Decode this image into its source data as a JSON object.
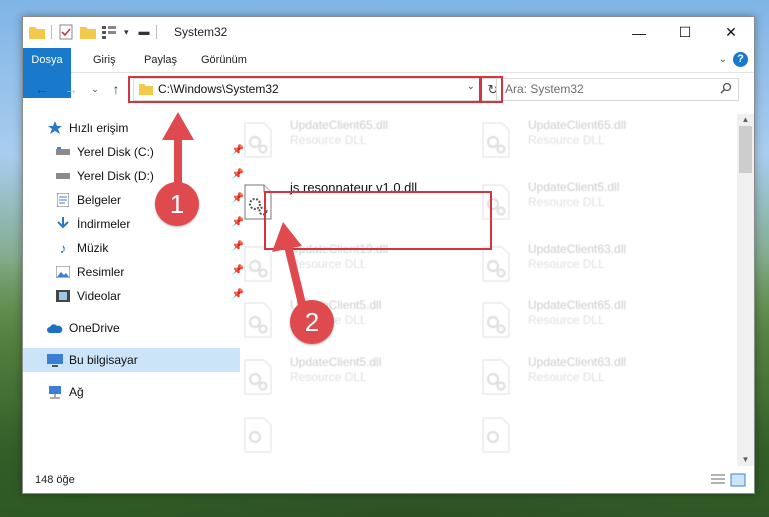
{
  "window": {
    "title": "System32",
    "controls": {
      "minimize_icon": "minimize-icon",
      "maximize_icon": "maximize-icon",
      "close_icon": "close-icon"
    }
  },
  "ribbon": {
    "tabs": [
      {
        "label": "Dosya"
      },
      {
        "label": "Giriş"
      },
      {
        "label": "Paylaş"
      },
      {
        "label": "Görünüm"
      }
    ]
  },
  "address": {
    "path": "C:\\Windows\\System32",
    "search_placeholder": "Ara: System32"
  },
  "sidebar": {
    "items": [
      {
        "label": "Hızlı erişim"
      },
      {
        "label": "Yerel Disk (C:)"
      },
      {
        "label": "Yerel Disk (D:)"
      },
      {
        "label": "Belgeler"
      },
      {
        "label": "İndirmeler"
      },
      {
        "label": "Müzik"
      },
      {
        "label": "Resimler"
      },
      {
        "label": "Videolar"
      },
      {
        "label": "OneDrive"
      },
      {
        "label": "Bu bilgisayar"
      },
      {
        "label": "Ağ"
      }
    ]
  },
  "files": [
    {
      "name": "UpdateClient65.dll",
      "type": "Resource DLL"
    },
    {
      "name": "UpdateClient65.dll",
      "type": "Resource DLL"
    },
    {
      "name": "js resonnateur v1.0.dll",
      "type": ""
    },
    {
      "name": "UpdateClient5.dll",
      "type": "Resource DLL"
    },
    {
      "name": "UpdateClient19.dll",
      "type": "Resource DLL"
    },
    {
      "name": "UpdateClient63.dll",
      "type": "Resource DLL"
    },
    {
      "name": "UpdateClient5.dll",
      "type": "Resource DLL"
    },
    {
      "name": "UpdateClient65.dll",
      "type": "Resource DLL"
    },
    {
      "name": "UpdateClient5.dll",
      "type": "Resource DLL"
    },
    {
      "name": "UpdateClient63.dll",
      "type": "Resource DLL"
    }
  ],
  "status": {
    "count": "148 öğe"
  },
  "annotations": {
    "badge1": "1",
    "badge2": "2"
  },
  "colors": {
    "accent": "#1979ca",
    "highlight": "#d1353d",
    "selection": "#cce4f7"
  }
}
